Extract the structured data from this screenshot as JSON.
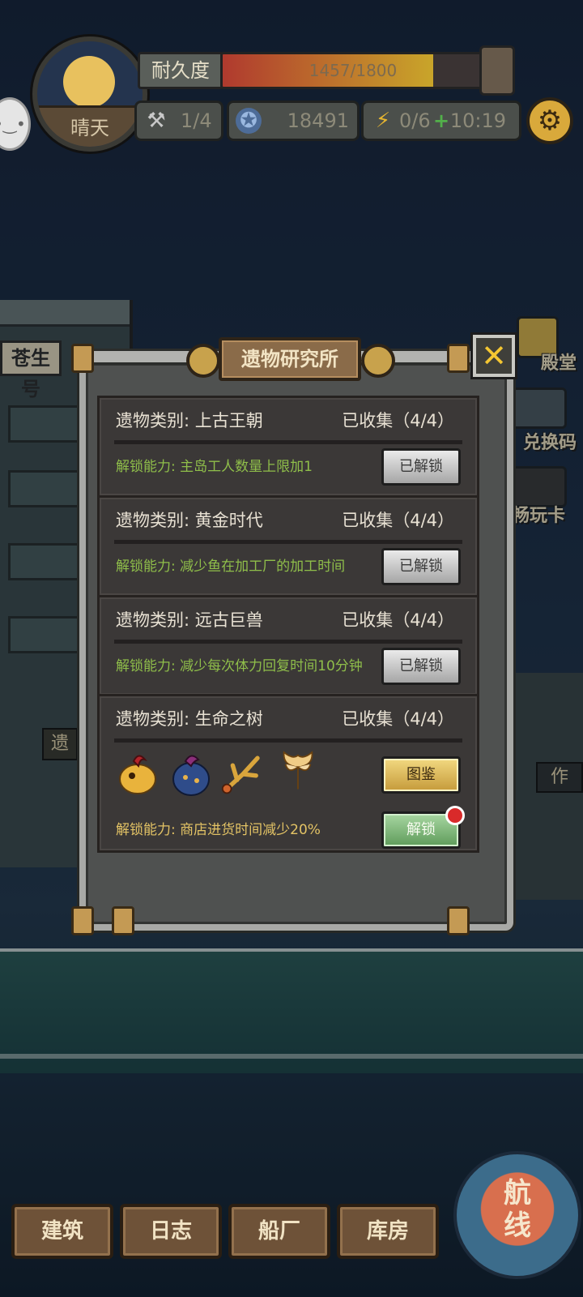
{
  "hud": {
    "weather": "晴天",
    "durability_label": "耐久度",
    "durability_value": "1457/1800",
    "durability_fraction": 0.809,
    "workers": "1/4",
    "coins": "18491",
    "energy": "0/6",
    "timer": "10:19"
  },
  "background": {
    "shop_sign": "苍生号",
    "side_labels": [
      "殿堂",
      "兑换码",
      "畅玩卡",
      "作"
    ],
    "left_tag": "遗"
  },
  "panel": {
    "title": "遗物研究所",
    "entries": [
      {
        "category": "遗物类别: 上古王朝",
        "collected": "已收集（4/4）",
        "ability": "解锁能力: 主岛工人数量上限加1",
        "button": "已解锁"
      },
      {
        "category": "遗物类别: 黄金时代",
        "collected": "已收集（4/4）",
        "ability": "解锁能力: 减少鱼在加工厂的加工时间",
        "button": "已解锁"
      },
      {
        "category": "遗物类别: 远古巨兽",
        "collected": "已收集（4/4）",
        "ability": "解锁能力: 减少每次体力回复时间10分钟",
        "button": "已解锁"
      },
      {
        "category": "遗物类别: 生命之树",
        "collected": "已收集（4/4）",
        "ability": "解锁能力: 商店进货时间减少20%",
        "codex_button": "图鉴",
        "button": "解锁"
      }
    ],
    "relic_icons": [
      "golden-fruit-creature-icon",
      "blue-seed-pod-icon",
      "golden-branch-icon",
      "golden-leaf-icon"
    ]
  },
  "nav": {
    "items": [
      "建筑",
      "日志",
      "船厂",
      "库房"
    ],
    "route": "航线"
  },
  "colors": {
    "ability_green": "#8fbe4a",
    "ability_gold": "#e3c365",
    "button_green": "#5e9b5a",
    "button_gold": "#c59a3a"
  }
}
